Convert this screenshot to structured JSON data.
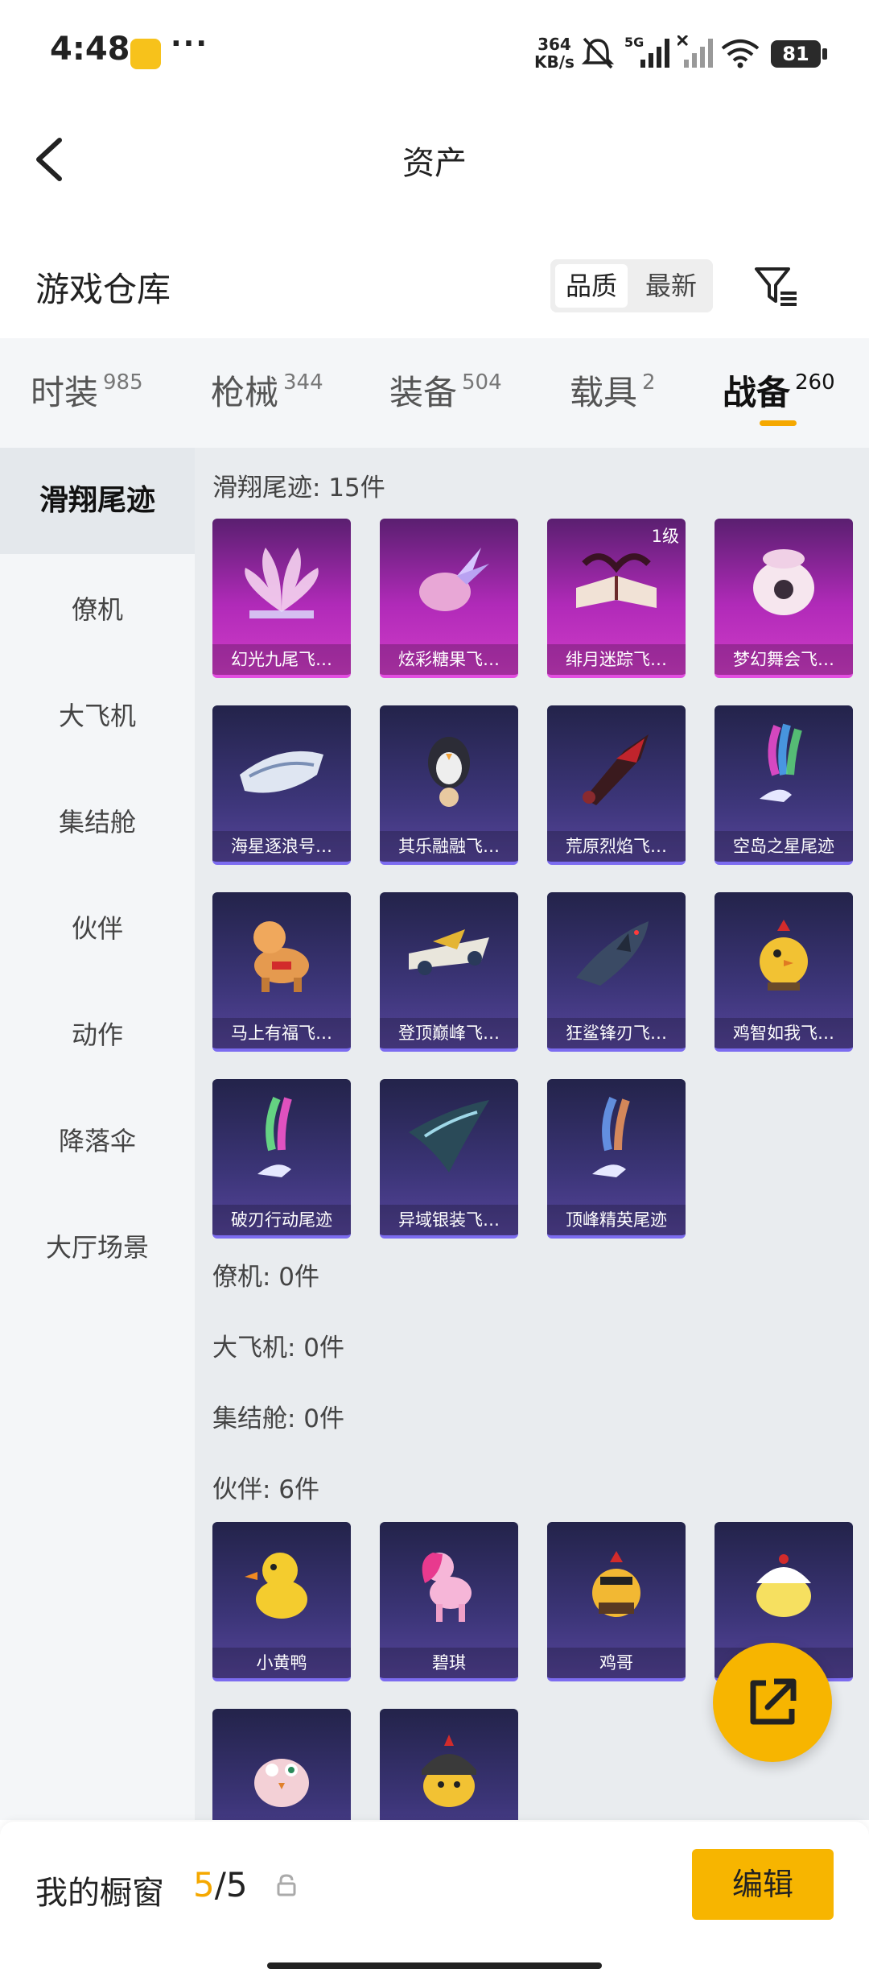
{
  "status_bar": {
    "time": "4:48",
    "net_speed_value": "364",
    "net_speed_unit": "KB/s",
    "network": "5G",
    "battery": "81",
    "icons": [
      "app-badge-icon",
      "more-dots-icon",
      "mute-icon",
      "signal-icon",
      "no-signal-icon",
      "wifi-icon",
      "battery-icon"
    ]
  },
  "header": {
    "title": "资产",
    "back_icon": "back-chevron-icon"
  },
  "section": {
    "title": "游戏仓库",
    "sort_options": [
      "品质",
      "最新"
    ],
    "sort_selected": "品质",
    "filter_icon": "filter-icon"
  },
  "tabs": [
    {
      "label": "时装",
      "count": "985"
    },
    {
      "label": "枪械",
      "count": "344"
    },
    {
      "label": "装备",
      "count": "504"
    },
    {
      "label": "载具",
      "count": "2"
    },
    {
      "label": "战备",
      "count": "260",
      "active": true
    }
  ],
  "sidenav": [
    "滑翔尾迹",
    "僚机",
    "大飞机",
    "集结舱",
    "伙伴",
    "动作",
    "降落伞",
    "大厅场景"
  ],
  "groups": {
    "glide": {
      "title": "滑翔尾迹: 15件",
      "items": [
        {
          "name": "幻光九尾飞…",
          "rarity": "purple"
        },
        {
          "name": "炫彩糖果飞…",
          "rarity": "purple"
        },
        {
          "name": "绯月迷踪飞…",
          "rarity": "purple",
          "level": "1级"
        },
        {
          "name": "梦幻舞会飞…",
          "rarity": "purple"
        },
        {
          "name": "海星逐浪号…",
          "rarity": "blue"
        },
        {
          "name": "其乐融融飞…",
          "rarity": "blue"
        },
        {
          "name": "荒原烈焰飞…",
          "rarity": "blue"
        },
        {
          "name": "空岛之星尾迹",
          "rarity": "blue"
        },
        {
          "name": "马上有福飞…",
          "rarity": "blue"
        },
        {
          "name": "登顶巅峰飞…",
          "rarity": "blue"
        },
        {
          "name": "狂鲨锋刃飞…",
          "rarity": "blue"
        },
        {
          "name": "鸡智如我飞…",
          "rarity": "blue"
        },
        {
          "name": "破刃行动尾迹",
          "rarity": "blue"
        },
        {
          "name": "异域银装飞…",
          "rarity": "blue"
        },
        {
          "name": "顶峰精英尾迹",
          "rarity": "blue"
        }
      ]
    },
    "wingman": {
      "title": "僚机: 0件"
    },
    "big_plane": {
      "title": "大飞机: 0件"
    },
    "pod": {
      "title": "集结舱: 0件"
    },
    "partner": {
      "title": "伙伴: 6件",
      "items": [
        {
          "name": "小黄鸭"
        },
        {
          "name": "碧琪"
        },
        {
          "name": "鸡哥"
        },
        {
          "name": ""
        },
        {
          "name": ""
        },
        {
          "name": ""
        }
      ]
    }
  },
  "bottom": {
    "label": "我的橱窗",
    "current": "5",
    "separator": "/",
    "total": "5",
    "edit_label": "编辑"
  },
  "colors": {
    "accent": "#f7b500",
    "purple_card": "#b02ab8",
    "blue_card": "#3c3578"
  }
}
